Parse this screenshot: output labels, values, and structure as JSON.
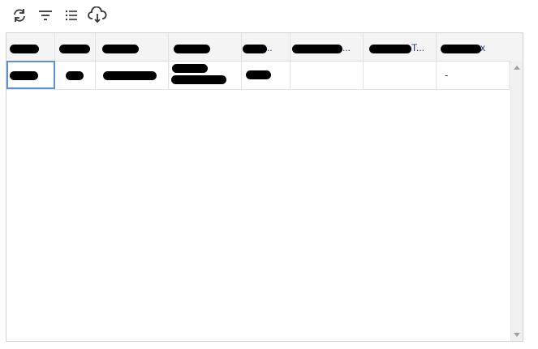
{
  "toolbar": {
    "buttons": [
      {
        "name": "refresh-icon"
      },
      {
        "name": "filter-icon"
      },
      {
        "name": "columns-list-icon"
      },
      {
        "name": "cloud-download-icon"
      }
    ]
  },
  "table": {
    "columns": [
      {
        "label": "",
        "redacted": true
      },
      {
        "label": "",
        "redacted": true
      },
      {
        "label": "",
        "redacted": true
      },
      {
        "label": "",
        "redacted": true
      },
      {
        "label": "",
        "redacted": true
      },
      {
        "label": "",
        "redacted": true
      },
      {
        "label": "",
        "redacted": true
      },
      {
        "label": "",
        "redacted": true
      }
    ],
    "rows": [
      {
        "cells": [
          "",
          "",
          "",
          "",
          "",
          "",
          "",
          "-"
        ]
      }
    ]
  },
  "colors": {
    "selection": "#5b8fd6",
    "header_bg": "#f4f4f4",
    "ellipsis": "#1f3b7a"
  }
}
